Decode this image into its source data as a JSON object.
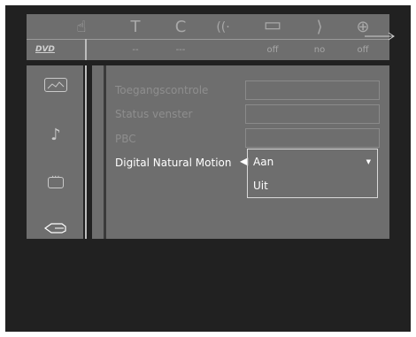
{
  "topbar": {
    "dvd_logo": "DVD",
    "items": [
      {
        "icon": "hand-icon",
        "glyph": "☝",
        "value": ""
      },
      {
        "icon": "title-icon",
        "glyph": "T",
        "value": "--"
      },
      {
        "icon": "chapter-icon",
        "glyph": "C",
        "value": "---"
      },
      {
        "icon": "audio-icon",
        "glyph": "((·",
        "value": ""
      },
      {
        "icon": "subtitle-icon",
        "glyph": "▭",
        "value": "off"
      },
      {
        "icon": "angle-icon",
        "glyph": "⟩",
        "value": "no"
      },
      {
        "icon": "zoom-icon",
        "glyph": "⊕",
        "value": "off"
      }
    ]
  },
  "sidebar": {
    "items": [
      {
        "icon": "picture-icon",
        "glyph": "▭"
      },
      {
        "icon": "music-note-icon",
        "glyph": "♪"
      },
      {
        "icon": "speech-bubble-icon",
        "glyph": "▢"
      },
      {
        "icon": "hand-pointer-icon",
        "glyph": "☜"
      }
    ]
  },
  "settings": {
    "rows": [
      {
        "label": "Toegangscontrole"
      },
      {
        "label": "Status venster"
      },
      {
        "label": "PBC"
      },
      {
        "label": "Digital Natural Motion"
      }
    ],
    "dropdown": {
      "selected": "Aan",
      "options": [
        "Aan",
        "Uit"
      ]
    }
  }
}
